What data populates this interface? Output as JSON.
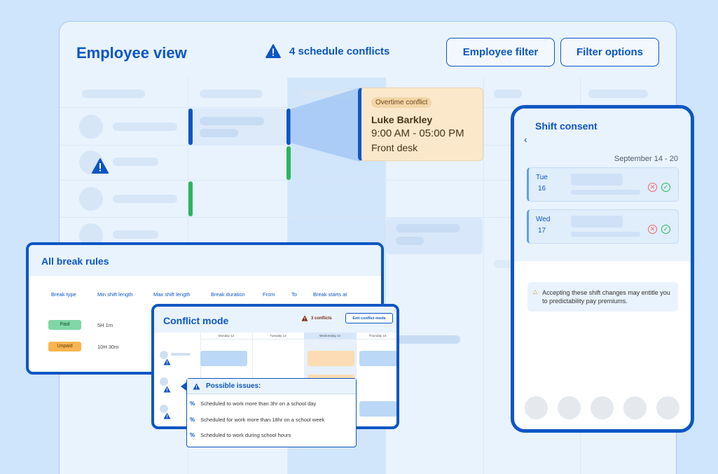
{
  "header": {
    "title": "Employee view",
    "conflicts_text": "4 schedule conflicts",
    "employee_filter_label": "Employee filter",
    "filter_options_label": "Filter options"
  },
  "overtime_popup": {
    "badge": "Overtime conflict",
    "name": "Luke Barkley",
    "time": "9:00 AM - 05:00 PM",
    "location": "Front desk"
  },
  "shift_consent": {
    "title": "Shift consent",
    "date_range": "September 14 - 20",
    "days": [
      {
        "day": "Tue",
        "date": "16"
      },
      {
        "day": "Wed",
        "date": "17"
      }
    ],
    "notice": "Accepting these shift changes may entitle you to predictability pay premiums."
  },
  "break_rules": {
    "title": "All break rules",
    "columns": [
      "Break type",
      "Min shift length",
      "Max shift length",
      "Break duration",
      "From",
      "To",
      "Break starts at"
    ],
    "rows": [
      {
        "type": "Paid",
        "min_shift": "5H 1m"
      },
      {
        "type": "Unpaid",
        "min_shift": "10H 30m"
      }
    ]
  },
  "conflict_mode": {
    "title": "Conflict mode",
    "count_text": "3 conflicts",
    "exit_label": "Exit conflict mode",
    "days": [
      "Monday 12",
      "Tuesday 13",
      "Wednesday 14",
      "Thursday 15"
    ]
  },
  "possible_issues": {
    "title": "Possible issues:",
    "items": [
      "Scheduled to work more than 3hr on a school day",
      "Scheduled for work more than 18hr on a school week",
      "Scheduled to work during school hours"
    ]
  },
  "colors": {
    "primary": "#0c56c4",
    "paid": "#7fd6a6",
    "unpaid": "#f8b550",
    "warning_bg": "#fbe8cb",
    "shift_green": "#2bb55c"
  }
}
